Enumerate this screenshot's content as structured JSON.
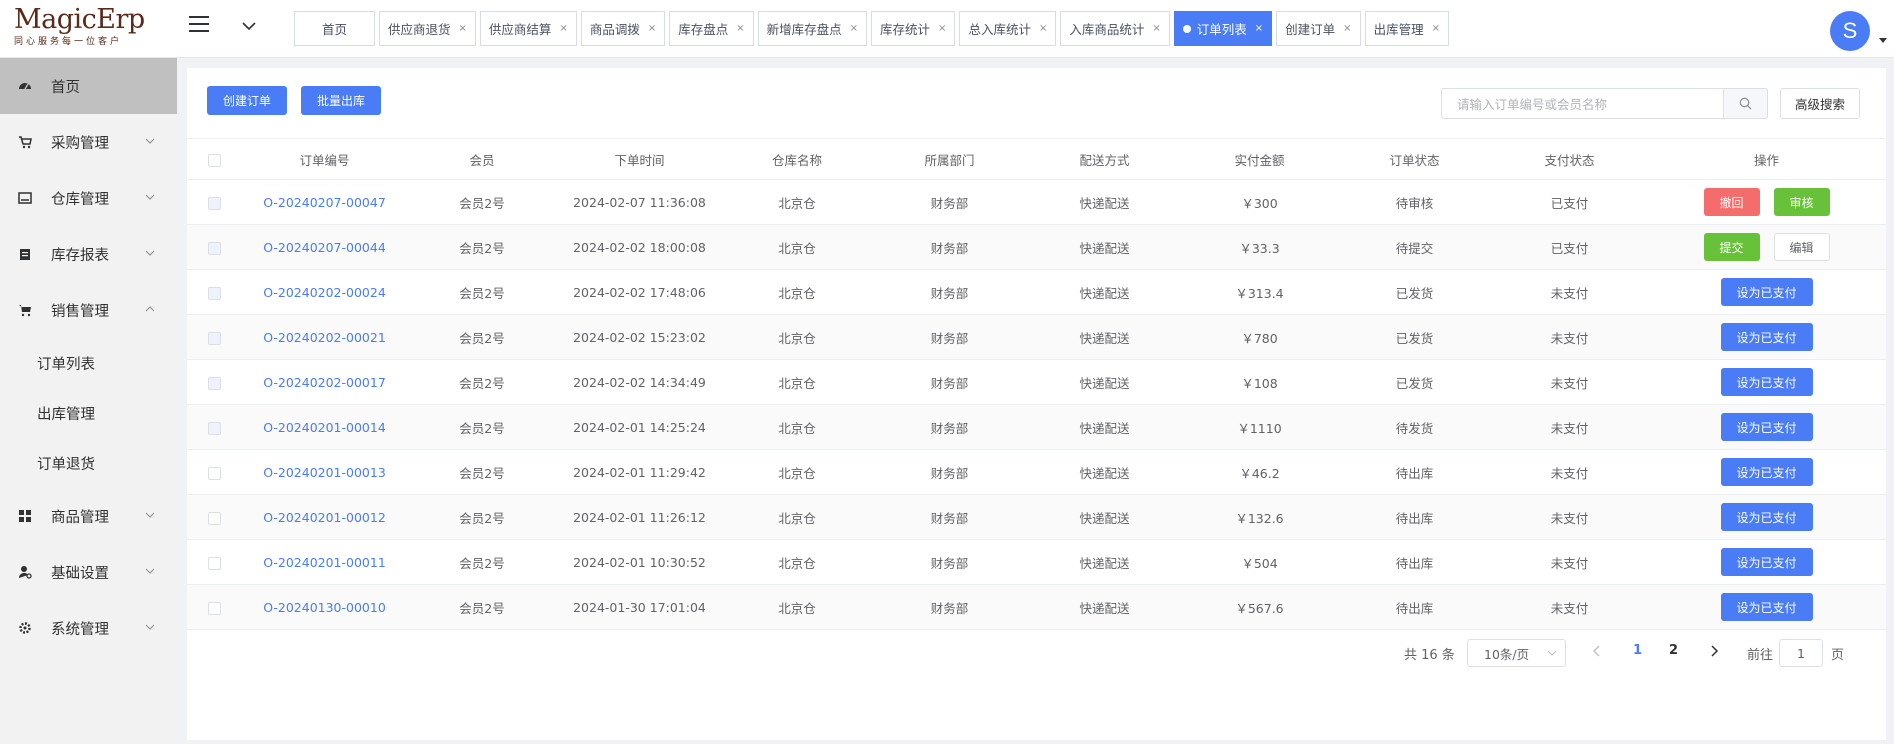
{
  "logo": {
    "main": "MagicErp",
    "sub": "同心服务每一位客户"
  },
  "tabs": [
    {
      "label": "首页",
      "closable": false,
      "active": false
    },
    {
      "label": "供应商退货",
      "closable": true,
      "active": false
    },
    {
      "label": "供应商结算",
      "closable": true,
      "active": false
    },
    {
      "label": "商品调拨",
      "closable": true,
      "active": false
    },
    {
      "label": "库存盘点",
      "closable": true,
      "active": false
    },
    {
      "label": "新增库存盘点",
      "closable": true,
      "active": false
    },
    {
      "label": "库存统计",
      "closable": true,
      "active": false
    },
    {
      "label": "总入库统计",
      "closable": true,
      "active": false
    },
    {
      "label": "入库商品统计",
      "closable": true,
      "active": false
    },
    {
      "label": "订单列表",
      "closable": true,
      "active": true
    },
    {
      "label": "创建订单",
      "closable": true,
      "active": false
    },
    {
      "label": "出库管理",
      "closable": true,
      "active": false
    }
  ],
  "tab_close_glyph": "×",
  "avatar": {
    "letter": "S",
    "color": "#4a7cf6"
  },
  "sidebar": {
    "home": "首页",
    "purchase": "采购管理",
    "warehouse": "仓库管理",
    "stock_report": "库存报表",
    "sales": "销售管理",
    "sales_sub": [
      "订单列表",
      "出库管理",
      "订单退货"
    ],
    "goods": "商品管理",
    "basic": "基础设置",
    "system": "系统管理"
  },
  "toolbar": {
    "create_order": "创建订单",
    "batch_outbound": "批量出库",
    "search_placeholder": "请输入订单编号或会员名称",
    "advanced_search": "高级搜索"
  },
  "table": {
    "headers": [
      "订单编号",
      "会员",
      "下单时间",
      "仓库名称",
      "所属部门",
      "配送方式",
      "实付金额",
      "订单状态",
      "支付状态",
      "操作"
    ],
    "rows": [
      {
        "order_no": "O-20240207-00047",
        "member": "会员2号",
        "time": "2024-02-07 11:36:08",
        "warehouse": "北京仓",
        "dept": "财务部",
        "delivery": "快递配送",
        "amount": "￥300",
        "status": "待审核",
        "pay": "已支付",
        "checkbox_disabled": true,
        "ops": [
          "撤回",
          "审核"
        ]
      },
      {
        "order_no": "O-20240207-00044",
        "member": "会员2号",
        "time": "2024-02-02 18:00:08",
        "warehouse": "北京仓",
        "dept": "财务部",
        "delivery": "快递配送",
        "amount": "￥33.3",
        "status": "待提交",
        "pay": "已支付",
        "checkbox_disabled": true,
        "ops": [
          "提交",
          "编辑"
        ]
      },
      {
        "order_no": "O-20240202-00024",
        "member": "会员2号",
        "time": "2024-02-02 17:48:06",
        "warehouse": "北京仓",
        "dept": "财务部",
        "delivery": "快递配送",
        "amount": "￥313.4",
        "status": "已发货",
        "pay": "未支付",
        "checkbox_disabled": true,
        "ops": [
          "设为已支付"
        ]
      },
      {
        "order_no": "O-20240202-00021",
        "member": "会员2号",
        "time": "2024-02-02 15:23:02",
        "warehouse": "北京仓",
        "dept": "财务部",
        "delivery": "快递配送",
        "amount": "￥780",
        "status": "已发货",
        "pay": "未支付",
        "checkbox_disabled": true,
        "ops": [
          "设为已支付"
        ]
      },
      {
        "order_no": "O-20240202-00017",
        "member": "会员2号",
        "time": "2024-02-02 14:34:49",
        "warehouse": "北京仓",
        "dept": "财务部",
        "delivery": "快递配送",
        "amount": "￥108",
        "status": "已发货",
        "pay": "未支付",
        "checkbox_disabled": true,
        "ops": [
          "设为已支付"
        ]
      },
      {
        "order_no": "O-20240201-00014",
        "member": "会员2号",
        "time": "2024-02-01 14:25:24",
        "warehouse": "北京仓",
        "dept": "财务部",
        "delivery": "快递配送",
        "amount": "￥1110",
        "status": "待发货",
        "pay": "未支付",
        "checkbox_disabled": true,
        "ops": [
          "设为已支付"
        ]
      },
      {
        "order_no": "O-20240201-00013",
        "member": "会员2号",
        "time": "2024-02-01 11:29:42",
        "warehouse": "北京仓",
        "dept": "财务部",
        "delivery": "快递配送",
        "amount": "￥46.2",
        "status": "待出库",
        "pay": "未支付",
        "checkbox_disabled": false,
        "ops": [
          "设为已支付"
        ]
      },
      {
        "order_no": "O-20240201-00012",
        "member": "会员2号",
        "time": "2024-02-01 11:26:12",
        "warehouse": "北京仓",
        "dept": "财务部",
        "delivery": "快递配送",
        "amount": "￥132.6",
        "status": "待出库",
        "pay": "未支付",
        "checkbox_disabled": false,
        "ops": [
          "设为已支付"
        ]
      },
      {
        "order_no": "O-20240201-00011",
        "member": "会员2号",
        "time": "2024-02-01 10:30:52",
        "warehouse": "北京仓",
        "dept": "财务部",
        "delivery": "快递配送",
        "amount": "￥504",
        "status": "待出库",
        "pay": "未支付",
        "checkbox_disabled": false,
        "ops": [
          "设为已支付"
        ]
      },
      {
        "order_no": "O-20240130-00010",
        "member": "会员2号",
        "time": "2024-01-30 17:01:04",
        "warehouse": "北京仓",
        "dept": "财务部",
        "delivery": "快递配送",
        "amount": "￥567.6",
        "status": "待出库",
        "pay": "未支付",
        "checkbox_disabled": false,
        "ops": [
          "设为已支付"
        ]
      }
    ]
  },
  "pagination": {
    "total": "共 16 条",
    "page_size": "10条/页",
    "pages": [
      "1",
      "2"
    ],
    "current": "1",
    "goto_label": "前往",
    "goto_value": "1",
    "page_suffix": "页"
  },
  "colors": {
    "primary": "#4a7cf6",
    "danger": "#f56c6c",
    "success": "#67c23a"
  }
}
